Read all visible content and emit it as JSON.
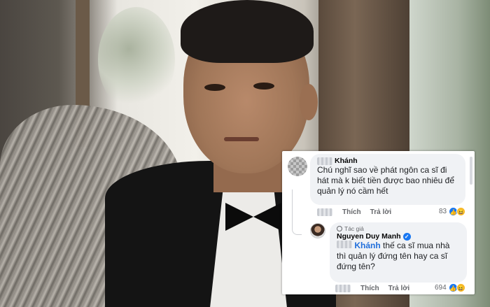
{
  "comments": [
    {
      "name": "Khánh",
      "text": "Chú nghĩ sao về phát ngôn ca sĩ đi hát mà k biết tiền được bao nhiêu để quản lý nó cầm hết",
      "actions": {
        "like": "Thích",
        "reply": "Trả lời"
      },
      "reaction_count": "83"
    },
    {
      "author_badge": "Tác giả",
      "name": "Nguyen Duy Manh",
      "mention": "Khánh",
      "text": " thế ca sĩ mua nhà thì quản lý đứng tên hay ca sĩ đứng tên?",
      "actions": {
        "like": "Thích",
        "reply": "Trả lời"
      },
      "reaction_count": "694"
    }
  ],
  "icons": {
    "like": "👍",
    "haha": "😆",
    "verified": "✓"
  },
  "colors": {
    "bubble_bg": "#f0f2f5",
    "mention": "#216fdb",
    "verified": "#1877f2",
    "secondary_text": "#65676b"
  }
}
